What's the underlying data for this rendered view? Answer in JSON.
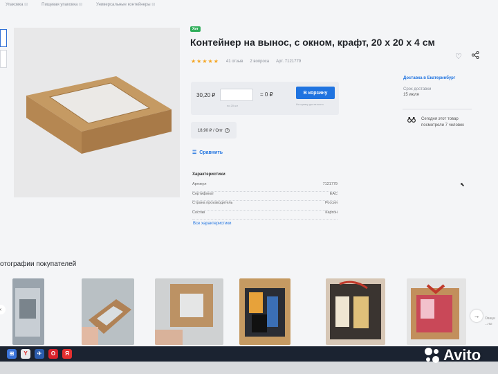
{
  "breadcrumbs": [
    "Упаковка",
    "Пищевая упаковка",
    "Универсальные контейнеры"
  ],
  "product": {
    "badge": "Хит",
    "title": "Контейнер на вынос, с окном, крафт, 20 х 20 х 4 см",
    "rating": 4.5,
    "reviews": "41 отзыв",
    "questions": "2 вопроса",
    "article": "Арт. 7121779"
  },
  "purchase": {
    "price": "30,20 ₽",
    "qty_hint": "по 20 шт",
    "total": "= 0 ₽",
    "cart_button": "В корзину",
    "cart_hint": "На сумму достаточно",
    "opt_price": "18,90 ₽ / Опт",
    "compare": "Сравнить"
  },
  "characteristics": {
    "title": "Характеристики",
    "rows": [
      {
        "label": "Артикул",
        "value": "7121779"
      },
      {
        "label": "Сертификат",
        "value": "EAC"
      },
      {
        "label": "Страна производитель",
        "value": "Россия"
      },
      {
        "label": "Состав",
        "value": "Картон"
      }
    ],
    "all_link": "Все характеристики"
  },
  "delivery": {
    "label": "Доставка в Екатеринбург",
    "term_label": "Срок доставки",
    "term_date": "15 июля",
    "viewers": "Сегодня этот товар посмотрели 7 человек"
  },
  "buyer_photos": {
    "title": "отографии покупателей",
    "edge_text": "Оваци ...ны"
  },
  "colors": {
    "accent": "#1f73e0",
    "badge": "#2fae5a",
    "stars": "#f5a623",
    "taskbar": "#1b2331"
  },
  "watermark": "Avito"
}
